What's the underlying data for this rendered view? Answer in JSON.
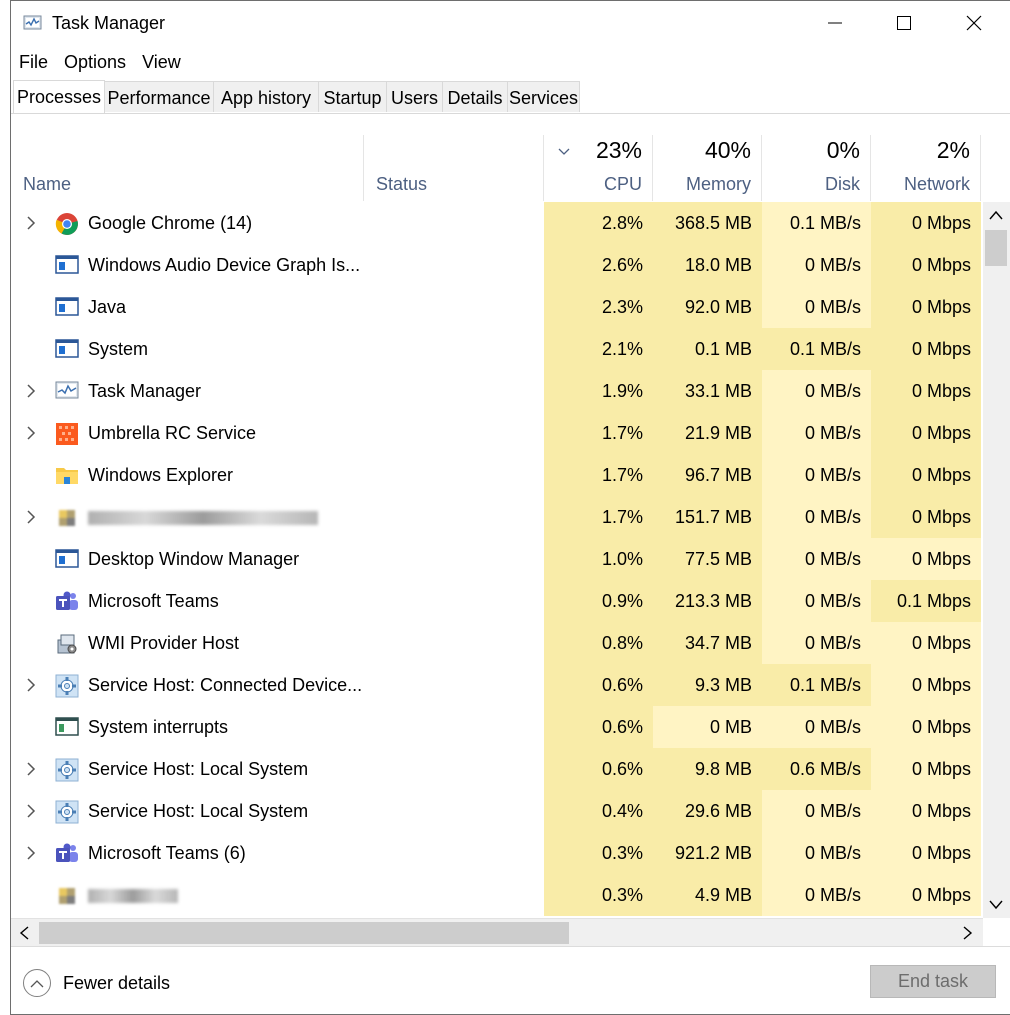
{
  "window": {
    "title": "Task Manager"
  },
  "menu": [
    "File",
    "Options",
    "View"
  ],
  "tabs": [
    "Processes",
    "Performance",
    "App history",
    "Startup",
    "Users",
    "Details",
    "Services"
  ],
  "columns": {
    "name": "Name",
    "status": "Status",
    "cpu": {
      "label": "CPU",
      "pct": "23%"
    },
    "memory": {
      "label": "Memory",
      "pct": "40%"
    },
    "disk": {
      "label": "Disk",
      "pct": "0%"
    },
    "network": {
      "label": "Network",
      "pct": "2%"
    }
  },
  "processes": [
    {
      "name": "Google Chrome (14)",
      "expandable": true,
      "icon": "chrome-icon",
      "cpu": "2.8%",
      "memory": "368.5 MB",
      "disk": "0.1 MB/s",
      "network": "0 Mbps"
    },
    {
      "name": "Windows Audio Device Graph Is...",
      "expandable": false,
      "icon": "app-window-icon",
      "cpu": "2.6%",
      "memory": "18.0 MB",
      "disk": "0 MB/s",
      "network": "0 Mbps"
    },
    {
      "name": "Java",
      "expandable": false,
      "icon": "app-window-icon",
      "cpu": "2.3%",
      "memory": "92.0 MB",
      "disk": "0 MB/s",
      "network": "0 Mbps"
    },
    {
      "name": "System",
      "expandable": false,
      "icon": "app-window-icon",
      "cpu": "2.1%",
      "memory": "0.1 MB",
      "disk": "0.1 MB/s",
      "network": "0 Mbps"
    },
    {
      "name": "Task Manager",
      "expandable": true,
      "icon": "task-manager-icon",
      "cpu": "1.9%",
      "memory": "33.1 MB",
      "disk": "0 MB/s",
      "network": "0 Mbps"
    },
    {
      "name": "Umbrella RC Service",
      "expandable": true,
      "icon": "umbrella-icon",
      "cpu": "1.7%",
      "memory": "21.9 MB",
      "disk": "0 MB/s",
      "network": "0 Mbps"
    },
    {
      "name": "Windows Explorer",
      "expandable": false,
      "icon": "folder-icon",
      "cpu": "1.7%",
      "memory": "96.7 MB",
      "disk": "0 MB/s",
      "network": "0 Mbps"
    },
    {
      "name": "",
      "expandable": true,
      "icon": "blurred-icon",
      "blurred": true,
      "cpu": "1.7%",
      "memory": "151.7 MB",
      "disk": "0 MB/s",
      "network": "0 Mbps"
    },
    {
      "name": "Desktop Window Manager",
      "expandable": false,
      "icon": "app-window-icon",
      "cpu": "1.0%",
      "memory": "77.5 MB",
      "disk": "0 MB/s",
      "network": "0 Mbps"
    },
    {
      "name": "Microsoft Teams",
      "expandable": false,
      "icon": "teams-icon",
      "cpu": "0.9%",
      "memory": "213.3 MB",
      "disk": "0 MB/s",
      "network": "0.1 Mbps"
    },
    {
      "name": "WMI Provider Host",
      "expandable": false,
      "icon": "wmi-icon",
      "cpu": "0.8%",
      "memory": "34.7 MB",
      "disk": "0 MB/s",
      "network": "0 Mbps"
    },
    {
      "name": "Service Host: Connected Device...",
      "expandable": true,
      "icon": "gear-icon",
      "cpu": "0.6%",
      "memory": "9.3 MB",
      "disk": "0.1 MB/s",
      "network": "0 Mbps"
    },
    {
      "name": "System interrupts",
      "expandable": false,
      "icon": "interrupts-icon",
      "cpu": "0.6%",
      "memory": "0 MB",
      "disk": "0 MB/s",
      "network": "0 Mbps"
    },
    {
      "name": "Service Host: Local System",
      "expandable": true,
      "icon": "gear-icon",
      "cpu": "0.6%",
      "memory": "9.8 MB",
      "disk": "0.6 MB/s",
      "network": "0 Mbps"
    },
    {
      "name": "Service Host: Local System",
      "expandable": true,
      "icon": "gear-icon",
      "cpu": "0.4%",
      "memory": "29.6 MB",
      "disk": "0 MB/s",
      "network": "0 Mbps"
    },
    {
      "name": "Microsoft Teams (6)",
      "expandable": true,
      "icon": "teams-icon",
      "cpu": "0.3%",
      "memory": "921.2 MB",
      "disk": "0 MB/s",
      "network": "0 Mbps"
    },
    {
      "name": "",
      "expandable": false,
      "icon": "blurred-icon",
      "blurred": true,
      "cpu": "0.3%",
      "memory": "4.9 MB",
      "disk": "0 MB/s",
      "network": "0 Mbps"
    }
  ],
  "footer": {
    "fewer_details": "Fewer details",
    "end_task": "End task"
  }
}
